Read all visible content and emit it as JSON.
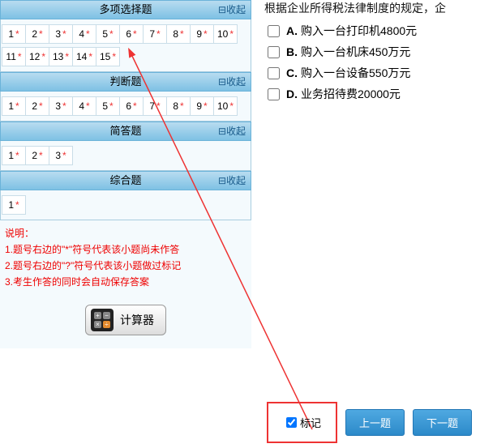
{
  "sections": [
    {
      "title": "多项选择题",
      "collapse": "⊟收起",
      "count": 15
    },
    {
      "title": "判断题",
      "collapse": "⊟收起",
      "count": 10
    },
    {
      "title": "简答题",
      "collapse": "⊟收起",
      "count": 3
    },
    {
      "title": "综合题",
      "collapse": "⊟收起",
      "count": 1
    }
  ],
  "notes": {
    "heading": "说明：",
    "line1": "1.题号右边的\"*\"符号代表该小题尚未作答",
    "line2": "2.题号右边的\"?\"符号代表该小题做过标记",
    "line3": "3.考生作答的同时会自动保存答案"
  },
  "calculator": "计算器",
  "question": {
    "stem_partial": "根据企业所得税法律制度的规定，企",
    "options": [
      {
        "letter": "A.",
        "text": "购入一台打印机4800元"
      },
      {
        "letter": "B.",
        "text": "购入一台机床450万元"
      },
      {
        "letter": "C.",
        "text": "购入一台设备550万元"
      },
      {
        "letter": "D.",
        "text": "业务招待费20000元"
      }
    ]
  },
  "footer": {
    "mark": "标记",
    "prev": "上一题",
    "next": "下一题"
  },
  "star": "*"
}
